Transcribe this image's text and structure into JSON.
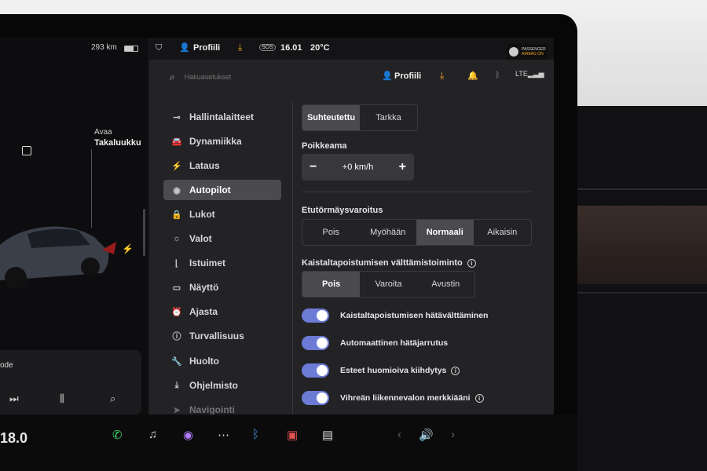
{
  "status_bar": {
    "range": "293 km",
    "profile_label": "Profiili",
    "time": "16.01",
    "temperature": "20°C",
    "sos_label": "SOS",
    "passenger_airbag_line1": "PASSENGER",
    "passenger_airbag_line2": "AIRBAG ON"
  },
  "left_panel": {
    "open_label": "Avaa",
    "trunk_label": "Takaluukku",
    "media_text": "ode"
  },
  "search": {
    "placeholder": "Hakuasetukset",
    "profile_label": "Profiili"
  },
  "sidebar": {
    "items": [
      {
        "label": "Hallintalaitteet",
        "icon": "toggle-icon",
        "active": false
      },
      {
        "label": "Dynamiikka",
        "icon": "car-icon",
        "active": false
      },
      {
        "label": "Lataus",
        "icon": "bolt-icon",
        "active": false
      },
      {
        "label": "Autopilot",
        "icon": "steering-wheel-icon",
        "active": true
      },
      {
        "label": "Lukot",
        "icon": "lock-icon",
        "active": false
      },
      {
        "label": "Valot",
        "icon": "sun-icon",
        "active": false
      },
      {
        "label": "Istuimet",
        "icon": "seat-icon",
        "active": false
      },
      {
        "label": "Näyttö",
        "icon": "display-icon",
        "active": false
      },
      {
        "label": "Ajasta",
        "icon": "alarm-clock-icon",
        "active": false
      },
      {
        "label": "Turvallisuus",
        "icon": "info-circle-icon",
        "active": false
      },
      {
        "label": "Huolto",
        "icon": "wrench-icon",
        "active": false
      },
      {
        "label": "Ohjelmisto",
        "icon": "download-icon",
        "active": false
      },
      {
        "label": "Navigointi",
        "icon": "navigation-icon",
        "active": false
      }
    ]
  },
  "autopilot": {
    "speed_mode": {
      "options": [
        "Suhteutettu",
        "Tarkka"
      ],
      "selected": "Suhteutettu"
    },
    "offset": {
      "label": "Poikkeama",
      "value": "+0 km/h",
      "minus": "−",
      "plus": "+"
    },
    "collision_warning": {
      "label": "Etutörmäysvaroitus",
      "options": [
        "Pois",
        "Myöhään",
        "Normaali",
        "Aikaisin"
      ],
      "selected": "Normaali"
    },
    "lane_departure": {
      "label": "Kaistaltapoistumisen välttämistoiminto",
      "options": [
        "Pois",
        "Varoita",
        "Avustin"
      ],
      "selected": "Pois"
    },
    "toggles": [
      {
        "label": "Kaistaltapoistumisen hätävälttäminen",
        "on": true,
        "info": false
      },
      {
        "label": "Automaattinen hätäjarrutus",
        "on": true,
        "info": false
      },
      {
        "label": "Esteet huomioiva kiihdytys",
        "on": true,
        "info": true
      },
      {
        "label": "Vihreän liikennevalon merkkiääni",
        "on": true,
        "info": true
      }
    ]
  },
  "bottom": {
    "temperature": "18.0"
  },
  "colors": {
    "toggle_on": "#6c7bd6",
    "accent_orange": "#f5a623",
    "panel_bg": "#232326"
  }
}
